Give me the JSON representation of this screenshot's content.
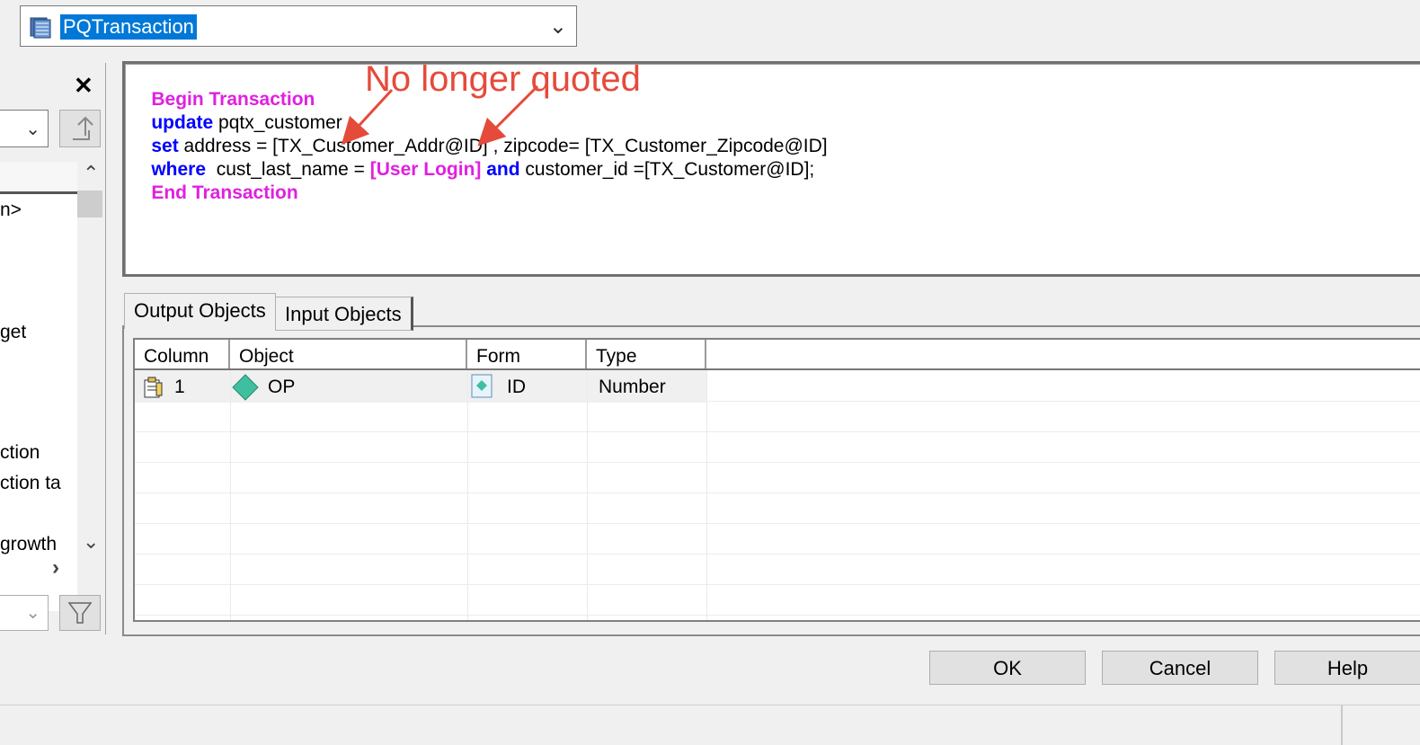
{
  "top_combo": {
    "value": "PQTransaction",
    "icon": "database-icon"
  },
  "left_pane": {
    "items": [
      "n>",
      "get",
      "ction",
      "ction ta",
      "growth"
    ]
  },
  "sql_editor": {
    "line1": {
      "kw": "Begin Transaction"
    },
    "line2": {
      "kw": "update",
      "rest": " pqtx_customer"
    },
    "line3": {
      "kw": "set",
      "rest": " address = [TX_Customer_Addr@ID] , zipcode= [TX_Customer_Zipcode@ID]"
    },
    "line4": {
      "kw1": "where",
      "rest1": "  cust_last_name = ",
      "param": "[User Login]",
      "sp": " ",
      "kw2": "and",
      "rest2": " customer_id =[TX_Customer@ID];"
    },
    "line5": {
      "kw": "End Transaction"
    }
  },
  "annotation": {
    "text": "No longer quoted",
    "color": "#e54b3a"
  },
  "tabs": {
    "output": "Output Objects",
    "input": "Input Objects"
  },
  "grid": {
    "columns": [
      "Column",
      "Object",
      "Form",
      "Type"
    ],
    "rows": [
      {
        "column": "1",
        "object": "OP",
        "form": "ID",
        "type": "Number"
      }
    ]
  },
  "buttons": {
    "ok": "OK",
    "cancel": "Cancel",
    "help": "Help"
  },
  "colors": {
    "keyword_pink": "#e020e0",
    "keyword_blue": "#0000ff",
    "selection": "#0078d7"
  }
}
